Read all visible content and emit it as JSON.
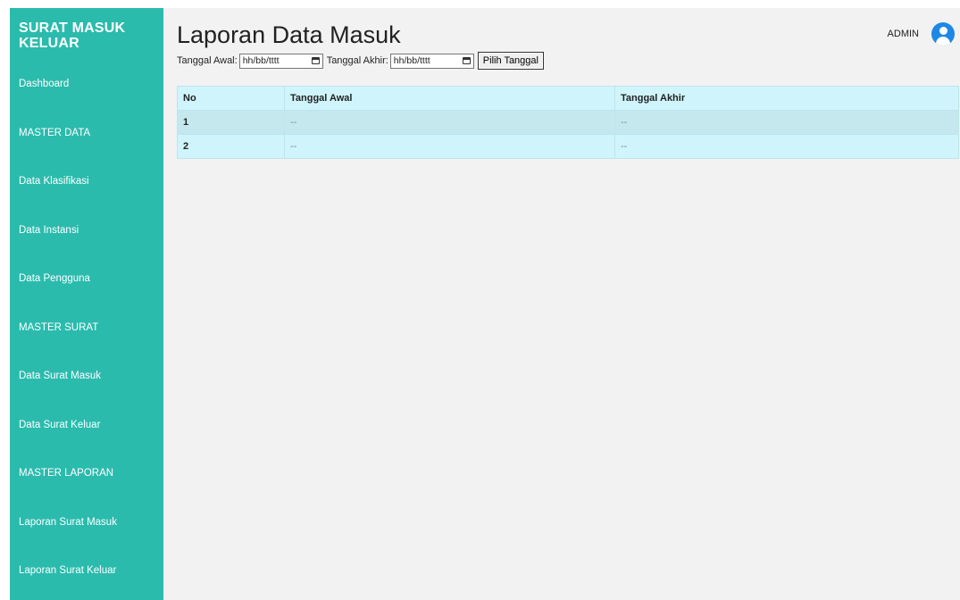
{
  "sidebar": {
    "brand": "SURAT MASUK KELUAR",
    "items": [
      {
        "label": "Dashboard"
      },
      {
        "label": "MASTER DATA"
      },
      {
        "label": "Data Klasifikasi"
      },
      {
        "label": "Data Instansi"
      },
      {
        "label": "Data Pengguna"
      },
      {
        "label": "MASTER SURAT"
      },
      {
        "label": "Data Surat Masuk"
      },
      {
        "label": "Data Surat Keluar"
      },
      {
        "label": "MASTER LAPORAN"
      },
      {
        "label": "Laporan Surat Masuk"
      },
      {
        "label": "Laporan Surat Keluar"
      }
    ]
  },
  "header": {
    "title": "Laporan Data Masuk",
    "user_label": "ADMIN"
  },
  "filter": {
    "start_label": "Tanggal Awal:",
    "start_value": "hh/bb/tttt",
    "end_label": "Tanggal Akhir:",
    "end_value": "hh/bb/tttt",
    "button_label": "Pilih Tanggal"
  },
  "table": {
    "headers": [
      "No",
      "Tanggal Awal",
      "Tanggal Akhir"
    ],
    "rows": [
      [
        "1",
        "--",
        "--"
      ],
      [
        "2",
        "--",
        "--"
      ]
    ]
  },
  "colors": {
    "sidebar_bg": "#2bbbad",
    "content_bg": "#f2f2f2",
    "table_header_bg": "#cff4fc",
    "avatar": "#1e88e5"
  }
}
